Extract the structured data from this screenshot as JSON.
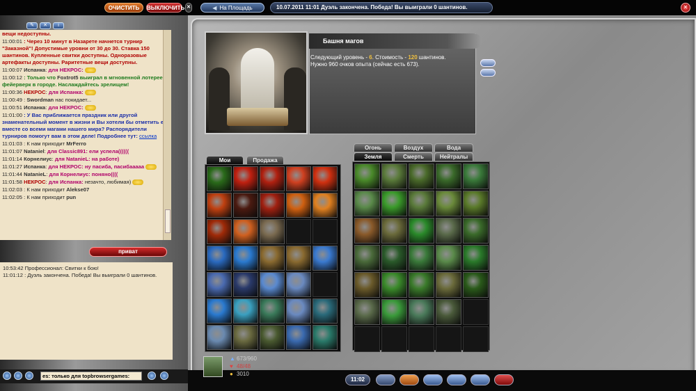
{
  "top": {
    "clear_label": "ОЧИСТИТЬ",
    "off_label": "ВЫКЛЮЧИТЬ",
    "square_label": "На Площадь",
    "status_message": "10.07.2011 11:01 Дуэль закончена. Победа! Вы выиграли 0 шантинов.",
    "exit_icon": "close-icon"
  },
  "chat": {
    "toolbar_icons": [
      "edit-icon",
      "x-icon",
      "info-icon"
    ],
    "lines": [
      {
        "t": "",
        "parts": [
          {
            "c": "red",
            "s": "вещи недоступны."
          }
        ]
      },
      {
        "t": "11:00:01",
        "parts": [
          {
            "c": "red",
            "s": ": Через 10 минут в Назарете начнется турнир \"Заказной\"! Допустимые уровни от 30 до 30. Ставка 150 шантинов. Купленные свитки доступны. Одноразовые артефакты доступны. Раритетные вещи доступны."
          }
        ]
      },
      {
        "t": "11:00:07",
        "parts": [
          {
            "c": "nick",
            "s": "Испанка"
          },
          {
            "c": "",
            "s": ": "
          },
          {
            "c": "pm",
            "s": "для НЕКРОС:"
          }
        ],
        "smiley": true
      },
      {
        "t": "11:00:12",
        "parts": [
          {
            "c": "green",
            "s": ": Только что "
          },
          {
            "c": "nick",
            "s": "Foxtrot5"
          },
          {
            "c": "green",
            "s": " выиграл в мгновенной лотерее фейерверк в городе. Наслаждайтесь зрелищем!"
          }
        ]
      },
      {
        "t": "11:00:36",
        "parts": [
          {
            "c": "red",
            "s": "НЕКРОС"
          },
          {
            "c": "",
            "s": ": "
          },
          {
            "c": "pm",
            "s": "для Испанка:"
          }
        ],
        "smiley": true
      },
      {
        "t": "11:00:49",
        "parts": [
          {
            "c": "",
            "s": ": "
          },
          {
            "c": "nick",
            "s": "Swordman"
          },
          {
            "c": "",
            "s": " нас покидает..."
          }
        ]
      },
      {
        "t": "11:00:51",
        "parts": [
          {
            "c": "nick",
            "s": "Испанка"
          },
          {
            "c": "",
            "s": ": "
          },
          {
            "c": "pm",
            "s": "для НЕКРОС:"
          }
        ],
        "smiley": true
      },
      {
        "t": "11:01:00",
        "parts": [
          {
            "c": "blue",
            "s": ": У Вас приближается праздник или другой знаменательный момент в жизни и Вы хотели бы отметить его вместе со всеми магами нашего мира? Распорядители турниров помогут вам в этом деле! Подробнее тут: "
          },
          {
            "c": "link",
            "s": "ссылка"
          }
        ]
      },
      {
        "t": "11:01:03",
        "parts": [
          {
            "c": "",
            "s": ": К нам приходит "
          },
          {
            "c": "nick",
            "s": "MrFerro"
          }
        ]
      },
      {
        "t": "11:01:07",
        "parts": [
          {
            "c": "nick",
            "s": "Nataniel"
          },
          {
            "c": "",
            "s": ": "
          },
          {
            "c": "pm",
            "s": "для Classic891: ели успела(((((("
          }
        ]
      },
      {
        "t": "11:01:14",
        "parts": [
          {
            "c": "nick",
            "s": "Корнелиус"
          },
          {
            "c": "",
            "s": ": "
          },
          {
            "c": "pm",
            "s": "для NataniеL: на работе)"
          }
        ]
      },
      {
        "t": "11:01:27",
        "parts": [
          {
            "c": "nick",
            "s": "Испанка"
          },
          {
            "c": "",
            "s": ": "
          },
          {
            "c": "pm",
            "s": "для НЕКРОС: ну пасиба, пасибааааа"
          }
        ],
        "smiley": true
      },
      {
        "t": "11:01:44",
        "parts": [
          {
            "c": "nick",
            "s": "NataniеL"
          },
          {
            "c": "",
            "s": ": "
          },
          {
            "c": "pm",
            "s": "для Корнелиус: поняно(((("
          }
        ]
      },
      {
        "t": "11:01:58",
        "parts": [
          {
            "c": "red",
            "s": "НЕКРОС"
          },
          {
            "c": "",
            "s": ": "
          },
          {
            "c": "pm",
            "s": "для Испанка:"
          },
          {
            "c": "",
            "s": " незачто, любимая)"
          }
        ],
        "smiley": true
      },
      {
        "t": "11:02:03",
        "parts": [
          {
            "c": "",
            "s": ": К нам приходит "
          },
          {
            "c": "nick",
            "s": "Alekse07"
          }
        ]
      },
      {
        "t": "11:02:05",
        "parts": [
          {
            "c": "",
            "s": ": К нам приходит "
          },
          {
            "c": "nick",
            "s": "pun"
          }
        ]
      }
    ],
    "private_label": "приват",
    "system_lines": [
      "10:53:42 Профессионал: Свитки к бою!",
      "11:01:12 : Дуэль закончена. Победа! Вы выиграли 0 шантинов."
    ],
    "input_value": "es: только для topbrowsergames:"
  },
  "location": {
    "title": "Башня магов",
    "desc_prefix": "Следующий уровень - ",
    "next_level": "6",
    "desc_mid": ". Стоимость - ",
    "cost": "120",
    "desc_cost_suffix": " шантинов.",
    "desc_line2": "Нужно 960 очков опыта (сейчас есть 673)."
  },
  "spells": {
    "my_tabs": [
      "Мои",
      "Продажа"
    ],
    "school_tabs_row1": [
      "Огонь",
      "Воздух",
      "Вода"
    ],
    "school_tabs_row2": [
      "Земля",
      "Смерть",
      "Нейтралы"
    ],
    "my_colors": [
      "#2a6a1a",
      "#c02010",
      "#b02010",
      "#d04020",
      "#d03010",
      "#c04010",
      "#4a1a10",
      "#a02010",
      "#d06010",
      "#e08020",
      "#a02a08",
      "#d06020",
      "#7a6a50",
      "empty",
      "empty",
      "#2a6ac0",
      "#2a7ad0",
      "#8a6a30",
      "#8a6a30",
      "#3a7ad0",
      "#4a6ab0",
      "#2a3a6a",
      "#5a8ad0",
      "#6a8ac0",
      "empty",
      "#2a7ad0",
      "#3aa0c0",
      "#3a7a5a",
      "#6a8ac0",
      "#2a6a7a",
      "#6a8ab0",
      "#6a6a40",
      "#4a5a30",
      "#3a6ab0",
      "#2a7a6a"
    ],
    "school_colors": [
      "#4a8a2a",
      "#5a7a3a",
      "#4a6a2a",
      "#3a6a2a",
      "#3a7a3a",
      "#5a8a4a",
      "#3a9a2a",
      "#5a7a3a",
      "#6a8a3a",
      "#5a7a2a",
      "#8a5a2a",
      "#6a6a3a",
      "#2a8a2a",
      "#5a6a4a",
      "#3a6a2a",
      "#4a6a3a",
      "#2a5a2a",
      "#3a7a3a",
      "#5a8a4a",
      "#2a7a2a",
      "#6a5a2a",
      "#3a8a2a",
      "#3a7a2a",
      "#6a6a3a",
      "#2a5a1a",
      "#5a6a4a",
      "#3a9a3a",
      "#4a7a5a",
      "#4a5a3a",
      "empty",
      "empty",
      "empty",
      "empty",
      "empty",
      "empty"
    ]
  },
  "character": {
    "exp": "673/960",
    "hp": "48/48",
    "money": "3010"
  },
  "bottom": {
    "time": "11:02",
    "buttons": [
      "menu-icon",
      "megaphone-icon",
      "card-icon",
      "mail-icon",
      "arrows-icon",
      "close-icon"
    ]
  }
}
